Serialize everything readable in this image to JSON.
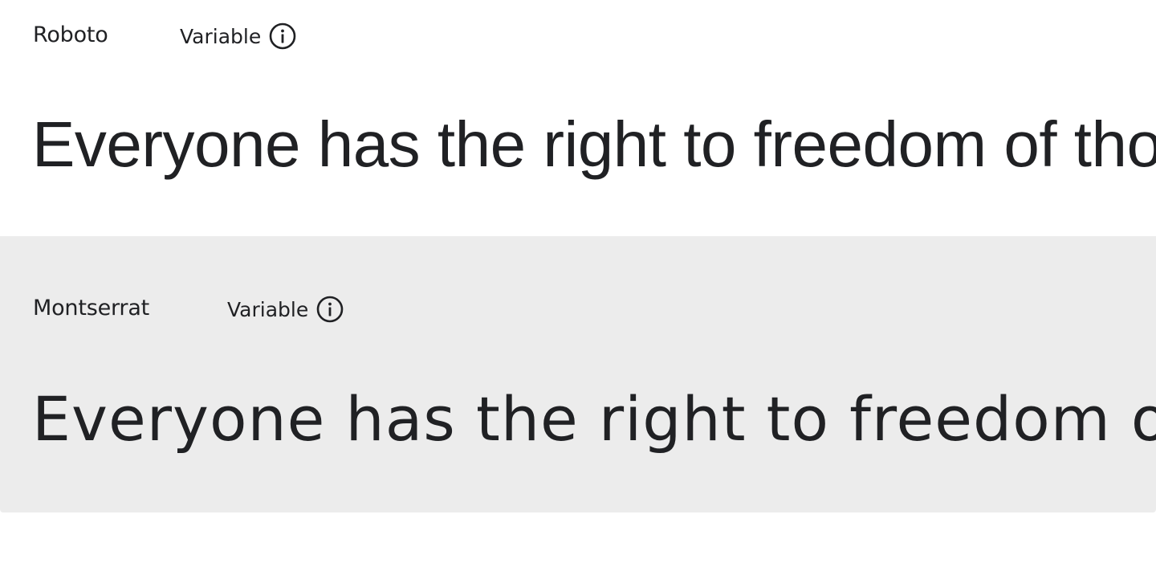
{
  "fonts": [
    {
      "family": "Roboto",
      "tag": "Variable",
      "info_icon": "info-circle-icon",
      "sample": "Everyone has the right to freedom of thought, conscience and religion"
    },
    {
      "family": "Montserrat",
      "tag": "Variable",
      "info_icon": "info-circle-icon",
      "sample": "Everyone has the right to freedom of thought, conscience and religion"
    }
  ],
  "colors": {
    "text": "#202124",
    "card_alt_background": "#ececec",
    "background": "#ffffff"
  }
}
